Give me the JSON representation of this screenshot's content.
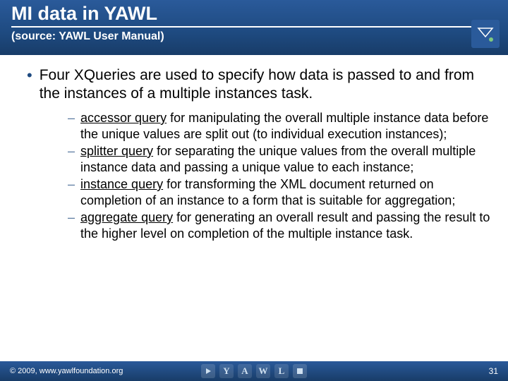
{
  "header": {
    "title": "MI data in YAWL",
    "subtitle": "(source: YAWL User Manual)"
  },
  "main_bullet": "Four XQueries are used to specify how data is passed to and from the instances of a multiple instances task.",
  "sub_items": [
    {
      "underline": "accessor query",
      "rest": " for manipulating the overall multiple instance data before the unique values are split out (to individual execution instances);"
    },
    {
      "underline": "splitter query",
      "rest": " for separating the unique values from the overall multiple instance data and passing a unique value to each instance;"
    },
    {
      "underline": "instance query",
      "rest": " for transforming the XML document returned on completion of an instance to a form that is suitable for aggregation;"
    },
    {
      "underline": "aggregate query",
      "rest": " for generating an overall result and passing the result to the higher level on completion of the multiple instance task."
    }
  ],
  "footer": {
    "copyright": "© 2009, www.yawlfoundation.org",
    "page": "31",
    "letters": [
      "Y",
      "A",
      "W",
      "L"
    ]
  }
}
